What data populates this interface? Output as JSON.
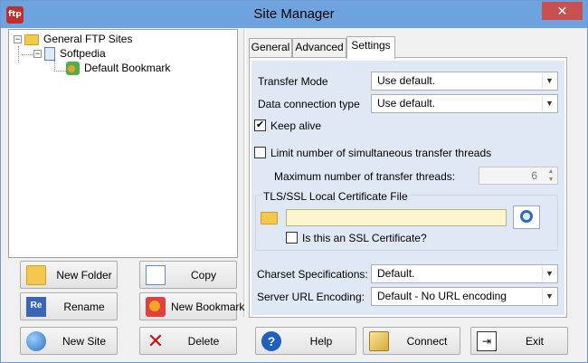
{
  "window": {
    "title": "Site Manager",
    "close_label": "✕",
    "app_icon_text": "ftp"
  },
  "tree": {
    "root": {
      "label": "General FTP Sites",
      "expander": "−"
    },
    "site": {
      "label": "Softpedia",
      "expander": "−"
    },
    "bookmark": {
      "label": "Default Bookmark"
    }
  },
  "left_buttons": {
    "new_folder": "New Folder",
    "copy": "Copy",
    "rename": "Rename",
    "new_bookmark": "New Bookmark",
    "new_site": "New Site",
    "delete": "Delete",
    "rename_icon_text": "Re"
  },
  "tabs": [
    {
      "label": "General"
    },
    {
      "label": "Advanced"
    },
    {
      "label": "Settings",
      "active": true
    }
  ],
  "settings": {
    "transfer_mode": {
      "label": "Transfer Mode",
      "value": "Use default."
    },
    "data_connection": {
      "label": "Data connection type",
      "value": "Use default."
    },
    "keep_alive": {
      "label": "Keep alive",
      "checked": true
    },
    "limit_threads": {
      "label": "Limit number of simultaneous transfer threads",
      "checked": false
    },
    "max_threads": {
      "label": "Maximum number of transfer threads:",
      "value": "6"
    },
    "cert_group": {
      "label": "TLS/SSL Local Certificate File",
      "value": ""
    },
    "ssl_cert": {
      "label": "Is this an SSL Certificate?",
      "checked": false
    },
    "charset": {
      "label": "Charset Specifications:",
      "value": "Default."
    },
    "url_encoding": {
      "label": "Server URL Encoding:",
      "value": "Default - No URL encoding"
    }
  },
  "bottom_buttons": {
    "help": "Help",
    "connect": "Connect",
    "exit": "Exit",
    "help_icon_text": "?"
  },
  "colors": {
    "titlebar": "#6fa3e0",
    "close": "#c75050",
    "settings_bg": "#dfe9f5",
    "cert_input": "#fbf6cd"
  }
}
